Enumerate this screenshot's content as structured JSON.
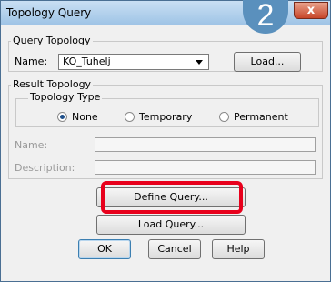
{
  "window": {
    "title": "Topology Query",
    "badge": "2",
    "close_label": "x"
  },
  "query_topology": {
    "group_label": "Query Topology",
    "name_label": "Name:",
    "name_value": "KO_Tuhelj",
    "load_button": "Load..."
  },
  "result_topology": {
    "group_label": "Result Topology",
    "type_group_label": "Topology Type",
    "radios": [
      {
        "label": "None",
        "selected": true
      },
      {
        "label": "Temporary",
        "selected": false
      },
      {
        "label": "Permanent",
        "selected": false
      }
    ],
    "name_label": "Name:",
    "description_label": "Description:"
  },
  "buttons": {
    "define_query": "Define Query...",
    "load_query": "Load Query...",
    "ok": "OK",
    "cancel": "Cancel",
    "help": "Help"
  },
  "colors": {
    "highlight": "#e8001c",
    "badge": "#5a90bd",
    "close": "#c7462a"
  }
}
